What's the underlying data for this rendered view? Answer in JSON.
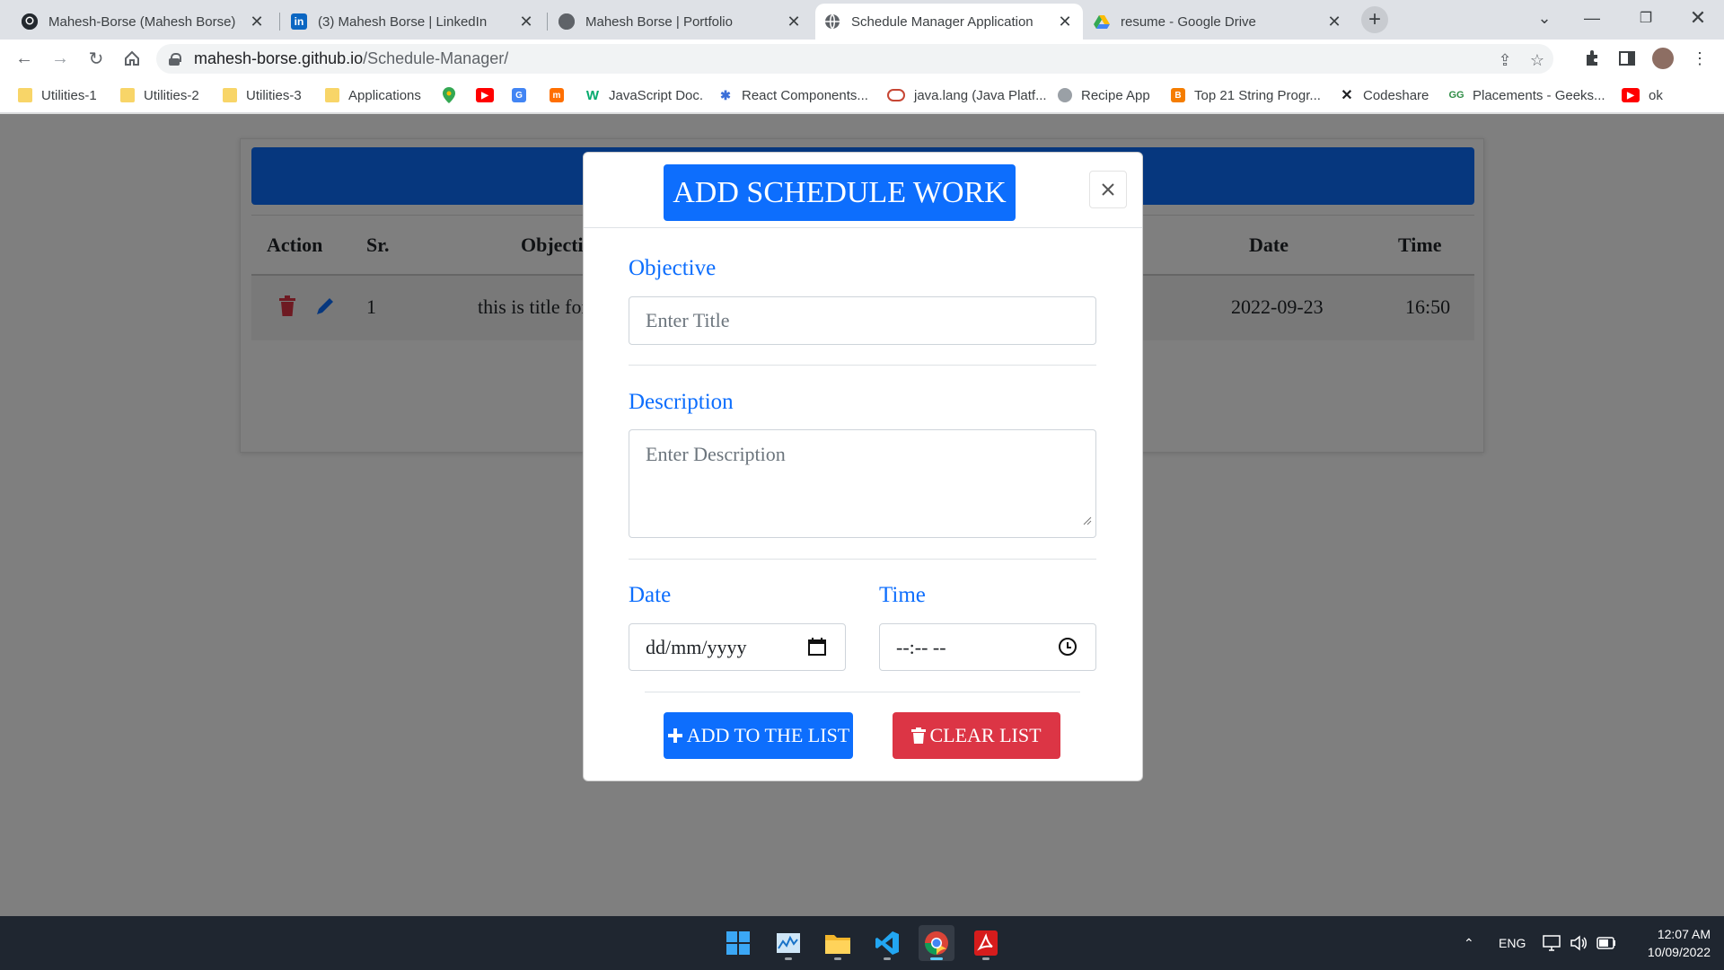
{
  "browser": {
    "tabs": [
      {
        "title": "Mahesh-Borse (Mahesh Borse)",
        "favicon": "github-icon",
        "active": false
      },
      {
        "title": "(3) Mahesh Borse | LinkedIn",
        "favicon": "linkedin-icon",
        "active": false
      },
      {
        "title": "Mahesh Borse | Portfolio",
        "favicon": "globe-icon",
        "active": false
      },
      {
        "title": "Schedule Manager Application",
        "favicon": "globe-icon",
        "active": true
      },
      {
        "title": "resume - Google Drive",
        "favicon": "google-drive-icon",
        "active": false
      }
    ],
    "url_host": "mahesh-borse.github.io",
    "url_path": "/Schedule-Manager/",
    "bookmarks": [
      {
        "label": "Utilities-1",
        "icon": "folder-icon"
      },
      {
        "label": "Utilities-2",
        "icon": "folder-icon"
      },
      {
        "label": "Utilities-3",
        "icon": "folder-icon"
      },
      {
        "label": "Applications",
        "icon": "folder-icon"
      },
      {
        "label": "",
        "icon": "maps-icon"
      },
      {
        "label": "",
        "icon": "youtube-icon"
      },
      {
        "label": "",
        "icon": "translate-icon"
      },
      {
        "label": "",
        "icon": "mi-icon"
      },
      {
        "label": "JavaScript Doc.",
        "icon": "w3-icon"
      },
      {
        "label": "React Components...",
        "icon": "react-bits-icon"
      },
      {
        "label": "java.lang (Java Platf...",
        "icon": "oracle-icon"
      },
      {
        "label": "Recipe App",
        "icon": "globe-icon"
      },
      {
        "label": "Top 21 String Progr...",
        "icon": "blogger-icon"
      },
      {
        "label": "Codeshare",
        "icon": "codeshare-icon"
      },
      {
        "label": "Placements - Geeks...",
        "icon": "gfg-icon"
      },
      {
        "label": "ok",
        "icon": "youtube-icon"
      }
    ]
  },
  "table": {
    "headers": {
      "action": "Action",
      "sr": "Sr.",
      "objective": "Objective",
      "date": "Date",
      "time": "Time"
    },
    "rows": [
      {
        "sr": "1",
        "objective": "this is title for",
        "date": "2022-09-23",
        "time": "16:50"
      }
    ]
  },
  "modal": {
    "title": "ADD SCHEDULE WORK",
    "objective_label": "Objective",
    "objective_placeholder": "Enter Title",
    "description_label": "Description",
    "description_placeholder": "Enter Description",
    "date_label": "Date",
    "date_placeholder": "dd/mm/yyyy",
    "time_label": "Time",
    "time_placeholder": "--:-- --",
    "add_button": "ADD TO THE LIST",
    "clear_button": "CLEAR LIST"
  },
  "colors": {
    "primary": "#0d6efd",
    "danger": "#dc3545",
    "header_dark": "#004aad"
  },
  "taskbar": {
    "apps": [
      "windows-start-icon",
      "task-manager-icon",
      "file-explorer-icon",
      "vscode-icon",
      "chrome-icon",
      "acrobat-icon"
    ],
    "language": "ENG",
    "time": "12:07 AM",
    "date": "10/09/2022"
  }
}
